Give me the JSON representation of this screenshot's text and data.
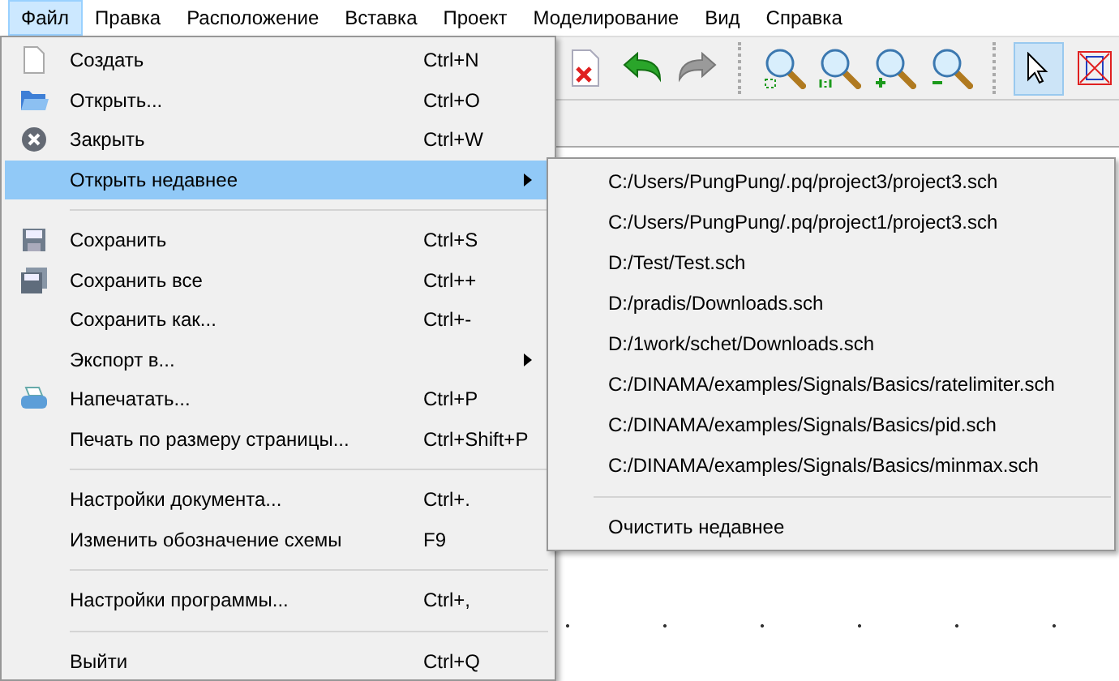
{
  "menubar": [
    {
      "label": "Файл",
      "selected": true
    },
    {
      "label": "Правка",
      "selected": false
    },
    {
      "label": "Расположение",
      "selected": false
    },
    {
      "label": "Вставка",
      "selected": false
    },
    {
      "label": "Проект",
      "selected": false
    },
    {
      "label": "Моделирование",
      "selected": false
    },
    {
      "label": "Вид",
      "selected": false
    },
    {
      "label": "Справка",
      "selected": false
    }
  ],
  "toolbar": [
    {
      "kind": "delete",
      "selected": false
    },
    {
      "kind": "undo",
      "selected": false
    },
    {
      "kind": "redo",
      "selected": false
    },
    {
      "kind": "separator"
    },
    {
      "kind": "zoom-fit",
      "selected": false
    },
    {
      "kind": "zoom-actual",
      "selected": false
    },
    {
      "kind": "zoom-in",
      "selected": false
    },
    {
      "kind": "zoom-out",
      "selected": false
    },
    {
      "kind": "separator"
    },
    {
      "kind": "select",
      "selected": true
    },
    {
      "kind": "frame",
      "selected": false
    }
  ],
  "file_menu": [
    {
      "kind": "item",
      "label": "Создать",
      "shortcut": "Ctrl+N",
      "selected": false,
      "submenu": false
    },
    {
      "kind": "item",
      "label": "Открыть...",
      "shortcut": "Ctrl+O",
      "selected": false,
      "submenu": false
    },
    {
      "kind": "item",
      "label": "Закрыть",
      "shortcut": "Ctrl+W",
      "selected": false,
      "submenu": false
    },
    {
      "kind": "item",
      "label": "Открыть недавнее",
      "selected": true,
      "submenu": true
    },
    {
      "kind": "separator"
    },
    {
      "kind": "item",
      "label": "Сохранить",
      "shortcut": "Ctrl+S",
      "selected": false,
      "submenu": false
    },
    {
      "kind": "item",
      "label": "Сохранить все",
      "shortcut": "Ctrl++",
      "selected": false,
      "submenu": false
    },
    {
      "kind": "item",
      "label": "Сохранить как...",
      "shortcut": "Ctrl+-",
      "selected": false,
      "submenu": false
    },
    {
      "kind": "item",
      "label": "Экспорт в...",
      "selected": false,
      "submenu": true
    },
    {
      "kind": "item",
      "label": "Напечатать...",
      "shortcut": "Ctrl+P",
      "selected": false,
      "submenu": false
    },
    {
      "kind": "item",
      "label": "Печать по размеру страницы...",
      "shortcut": "Ctrl+Shift+P",
      "selected": false,
      "submenu": false
    },
    {
      "kind": "separator"
    },
    {
      "kind": "item",
      "label": "Настройки документа...",
      "shortcut": "Ctrl+.",
      "selected": false,
      "submenu": false
    },
    {
      "kind": "item",
      "label": "Изменить обозначение схемы",
      "shortcut": "F9",
      "selected": false,
      "submenu": false
    },
    {
      "kind": "separator"
    },
    {
      "kind": "item",
      "label": "Настройки программы...",
      "shortcut": "Ctrl+,",
      "selected": false,
      "submenu": false
    },
    {
      "kind": "separator"
    },
    {
      "kind": "item",
      "label": "Выйти",
      "shortcut": "Ctrl+Q",
      "selected": false,
      "submenu": false
    }
  ],
  "recent_menu": [
    {
      "kind": "item",
      "label": "C:/Users/PungPung/.pq/project3/project3.sch"
    },
    {
      "kind": "item",
      "label": "C:/Users/PungPung/.pq/project1/project3.sch"
    },
    {
      "kind": "item",
      "label": "D:/Test/Test.sch"
    },
    {
      "kind": "item",
      "label": "D:/pradis/Downloads.sch"
    },
    {
      "kind": "item",
      "label": "D:/1work/schet/Downloads.sch"
    },
    {
      "kind": "item",
      "label": "C:/DINAMA/examples/Signals/Basics/ratelimiter.sch"
    },
    {
      "kind": "item",
      "label": "C:/DINAMA/examples/Signals/Basics/pid.sch"
    },
    {
      "kind": "item",
      "label": "C:/DINAMA/examples/Signals/Basics/minmax.sch"
    },
    {
      "kind": "separator"
    },
    {
      "kind": "item",
      "label": "Очистить недавнее"
    }
  ]
}
